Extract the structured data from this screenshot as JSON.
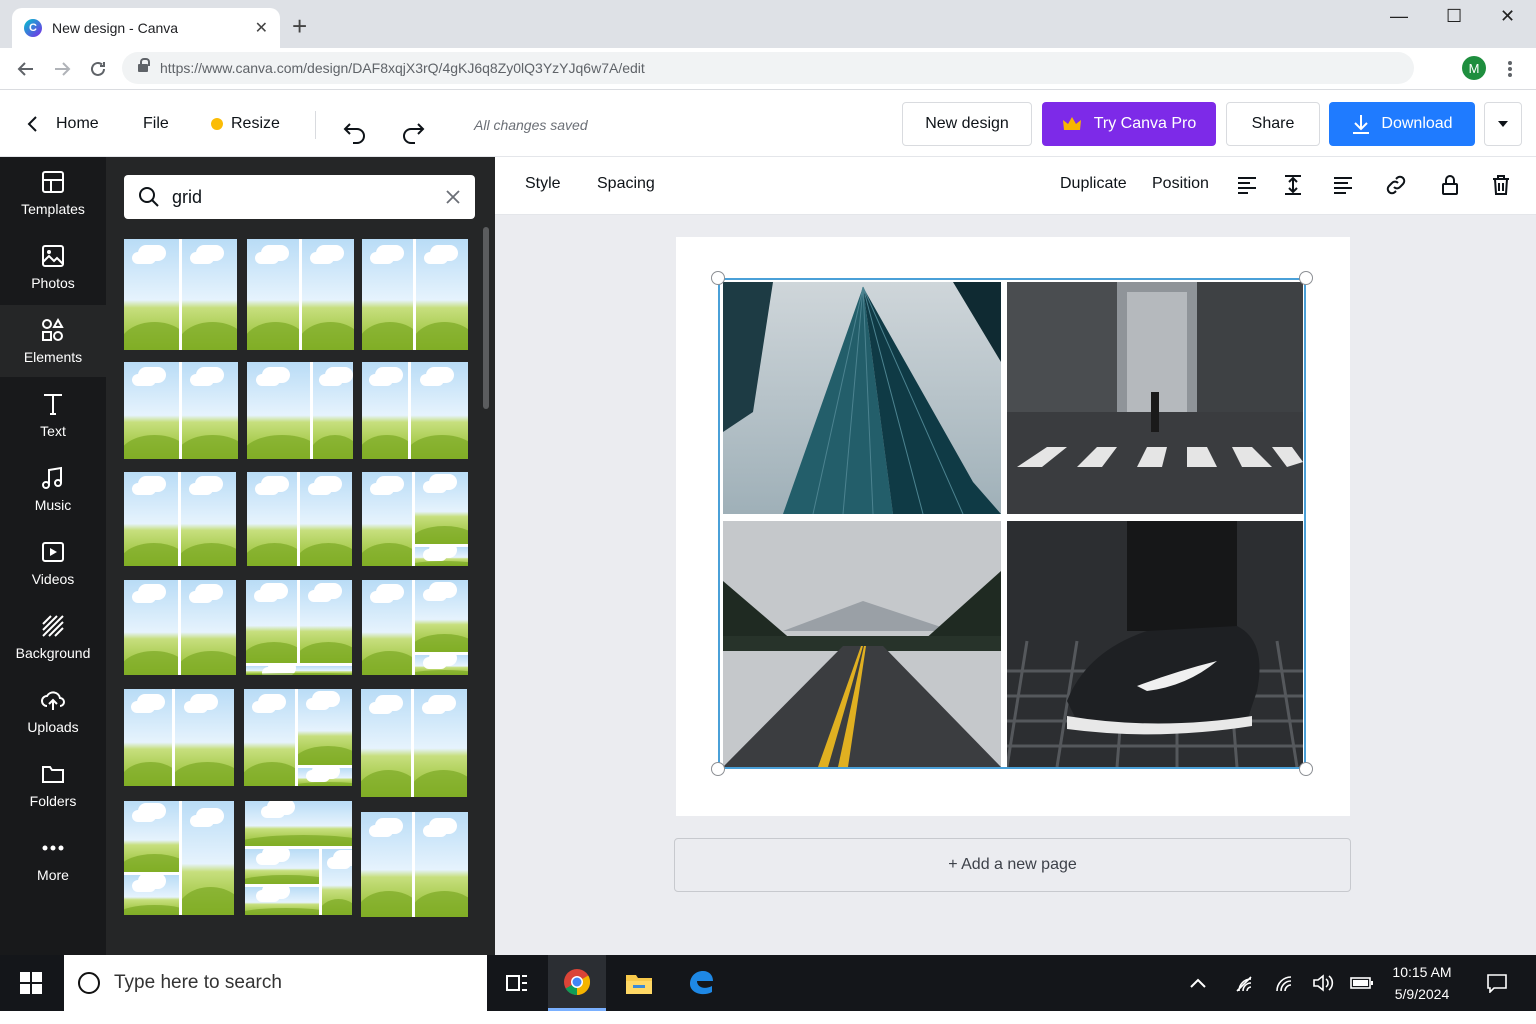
{
  "browser": {
    "tab_title": "New design - Canva",
    "tab_close": "✕",
    "new_tab": "+",
    "favicon_letter": "C",
    "url": "https://www.canva.com/design/DAF8xqjX3rQ/4gKJ6q8Zy0lQ3YzYJq6w7A/edit",
    "profile_initial": "M",
    "window_controls": {
      "minimize": "—",
      "maximize": "☐",
      "close": "✕"
    }
  },
  "header": {
    "home_label": "Home",
    "file_label": "File",
    "resize_label": "Resize",
    "saved_status": "All changes saved",
    "new_design_label": "New design",
    "try_pro_label": "Try Canva Pro",
    "share_label": "Share",
    "download_label": "Download",
    "accent_purple": "#7d2ae8",
    "accent_blue": "#1f7bff"
  },
  "sidebar": {
    "items": [
      {
        "label": "Templates",
        "icon": "templates-icon"
      },
      {
        "label": "Photos",
        "icon": "photos-icon"
      },
      {
        "label": "Elements",
        "icon": "elements-icon",
        "active": true
      },
      {
        "label": "Text",
        "icon": "text-icon"
      },
      {
        "label": "Music",
        "icon": "music-icon"
      },
      {
        "label": "Videos",
        "icon": "videos-icon"
      },
      {
        "label": "Background",
        "icon": "background-icon"
      },
      {
        "label": "Uploads",
        "icon": "uploads-icon"
      },
      {
        "label": "Folders",
        "icon": "folders-icon"
      },
      {
        "label": "More",
        "icon": "more-icon"
      }
    ]
  },
  "panel": {
    "search_value": "grid",
    "result_count": 18
  },
  "toolbar": {
    "style_label": "Style",
    "spacing_label": "Spacing",
    "duplicate_label": "Duplicate",
    "position_label": "Position"
  },
  "canvas": {
    "add_page_label": "+ Add a new page",
    "photos": [
      "skyscraper",
      "city-crosswalk",
      "mountain-road",
      "sneaker"
    ]
  },
  "taskbar": {
    "search_placeholder": "Type here to search",
    "time": "10:15 AM",
    "date": "5/9/2024"
  }
}
